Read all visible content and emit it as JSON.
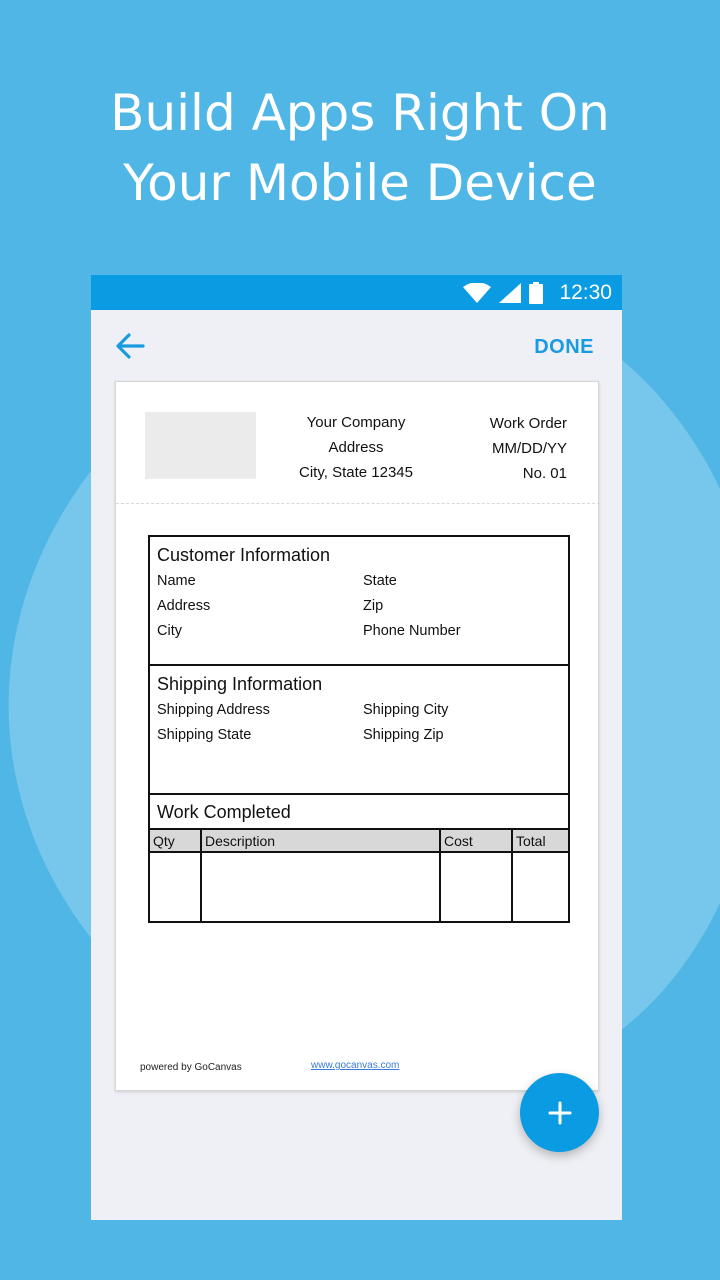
{
  "headline": {
    "line1": "Build Apps Right On",
    "line2": "Your Mobile Device"
  },
  "statusbar": {
    "time": "12:30",
    "icons": [
      "wifi-icon",
      "signal-icon",
      "battery-icon"
    ]
  },
  "appbar": {
    "back_icon": "arrow-left-icon",
    "done_label": "DONE"
  },
  "document": {
    "company": {
      "name": "Your Company",
      "address": "Address",
      "city_state_zip": "City, State 12345"
    },
    "work_order": {
      "title": "Work Order",
      "date": "MM/DD/YY",
      "number": "No. 01"
    },
    "customer": {
      "title": "Customer Information",
      "fields": [
        "Name",
        "State",
        "Address",
        "Zip",
        "City",
        "Phone Number"
      ]
    },
    "shipping": {
      "title": "Shipping Information",
      "fields": [
        "Shipping Address",
        "Shipping City",
        "Shipping State",
        "Shipping Zip"
      ]
    },
    "work_completed": {
      "title": "Work Completed",
      "columns": [
        "Qty",
        "Description",
        "Cost",
        "Total"
      ]
    },
    "footer": {
      "powered_by": "powered by GoCanvas",
      "website": "www.gocanvas.com"
    }
  },
  "fab": {
    "icon": "plus-icon"
  },
  "colors": {
    "background": "#4fb6e5",
    "accent": "#0b9be3",
    "done_text": "#1a9ae0"
  }
}
